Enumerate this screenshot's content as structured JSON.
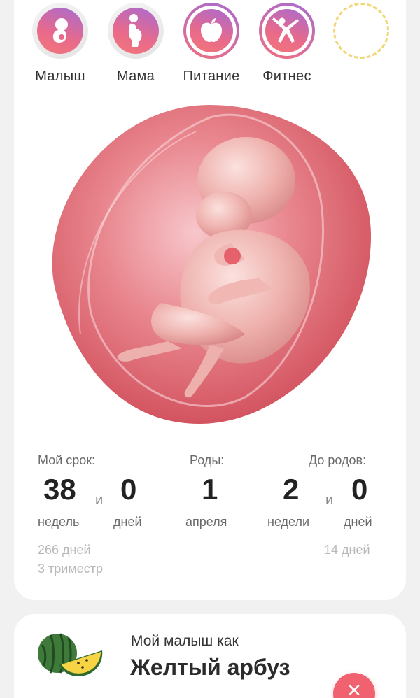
{
  "categories": [
    {
      "label": "Малыш",
      "icon": "baby-icon"
    },
    {
      "label": "Мама",
      "icon": "pregnant-woman-icon"
    },
    {
      "label": "Питание",
      "icon": "apple-icon"
    },
    {
      "label": "Фитнес",
      "icon": "fitness-icon"
    },
    {
      "label": "",
      "icon": "empty-slot"
    }
  ],
  "stats": {
    "term_label": "Мой срок:",
    "term_weeks": "38",
    "term_and": "и",
    "term_days": "0",
    "weeks_unit": "недель",
    "days_unit": "дней",
    "birth_label": "Роды:",
    "birth_day": "1",
    "birth_month": "апреля",
    "until_label": "До родов:",
    "until_weeks": "2",
    "until_and": "и",
    "until_days": "0",
    "until_weeks_unit": "недели",
    "until_days_unit": "дней",
    "total_days": "266 дней",
    "trimester": "3 триместр",
    "remaining_days": "14 дней"
  },
  "fruit": {
    "kicker": "Мой малыш как",
    "title": "Желтый арбуз",
    "close_icon": "✕"
  },
  "colors": {
    "accent": "#f0626f",
    "gradient_start": "#a86bd1",
    "gradient_end": "#f2777a"
  }
}
